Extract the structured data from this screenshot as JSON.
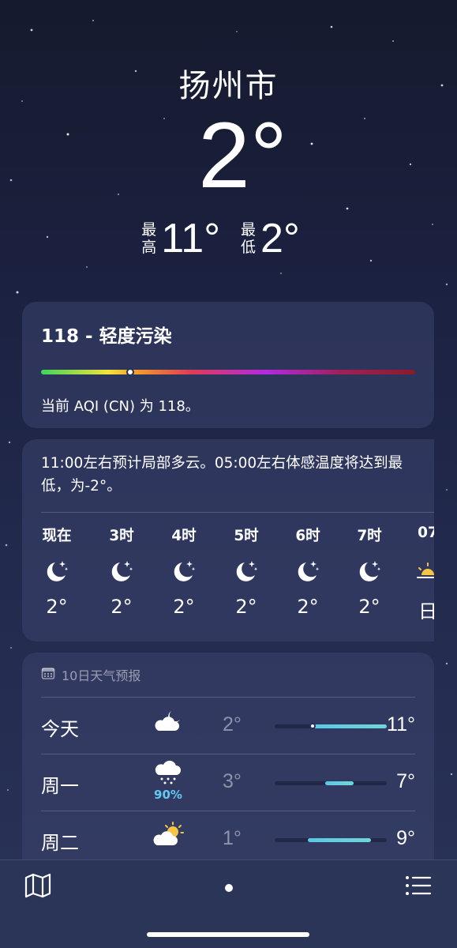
{
  "location": {
    "city": "扬州市",
    "current_temp": "2°"
  },
  "hilo": {
    "high_label": [
      "最",
      "高"
    ],
    "high": "11°",
    "low_label": [
      "最",
      "低"
    ],
    "low": "2°"
  },
  "aqi": {
    "title": "118 - 轻度污染",
    "description": "当前 AQI (CN) 为 118。",
    "value": 118
  },
  "hourly": {
    "summary": "11:00左右预计局部多云。05:00左右体感温度将达到最低，为-2°。",
    "items": [
      {
        "time": "现在",
        "icon": "moon-stars-icon",
        "temp": "2°"
      },
      {
        "time": "3时",
        "icon": "moon-stars-icon",
        "temp": "2°"
      },
      {
        "time": "4时",
        "icon": "moon-stars-icon",
        "temp": "2°"
      },
      {
        "time": "5时",
        "icon": "moon-stars-icon",
        "temp": "2°"
      },
      {
        "time": "6时",
        "icon": "moon-stars-icon",
        "temp": "2°"
      },
      {
        "time": "7时",
        "icon": "moon-stars-icon",
        "temp": "2°"
      },
      {
        "time": "07",
        "icon": "sunrise-icon",
        "temp": "日"
      }
    ]
  },
  "daily": {
    "header": "10日天气预报",
    "items": [
      {
        "day": "今天",
        "icon": "cloud-moon-icon",
        "pop": "",
        "low": "2°",
        "high": "11°",
        "current_marker": true
      },
      {
        "day": "周一",
        "icon": "cloud-snow-icon",
        "pop": "90%",
        "low": "3°",
        "high": "7°",
        "current_marker": false
      },
      {
        "day": "周二",
        "icon": "cloud-sun-icon",
        "pop": "",
        "low": "1°",
        "high": "9°",
        "current_marker": false
      }
    ]
  },
  "toolbar": {
    "map_icon": "map-icon",
    "page_indicator": "location-dot",
    "list_icon": "list-icon"
  },
  "colors": {
    "accent_blue": "#62c9f2",
    "range_bar": "#5cc7e6",
    "sun": "#f6c544"
  }
}
